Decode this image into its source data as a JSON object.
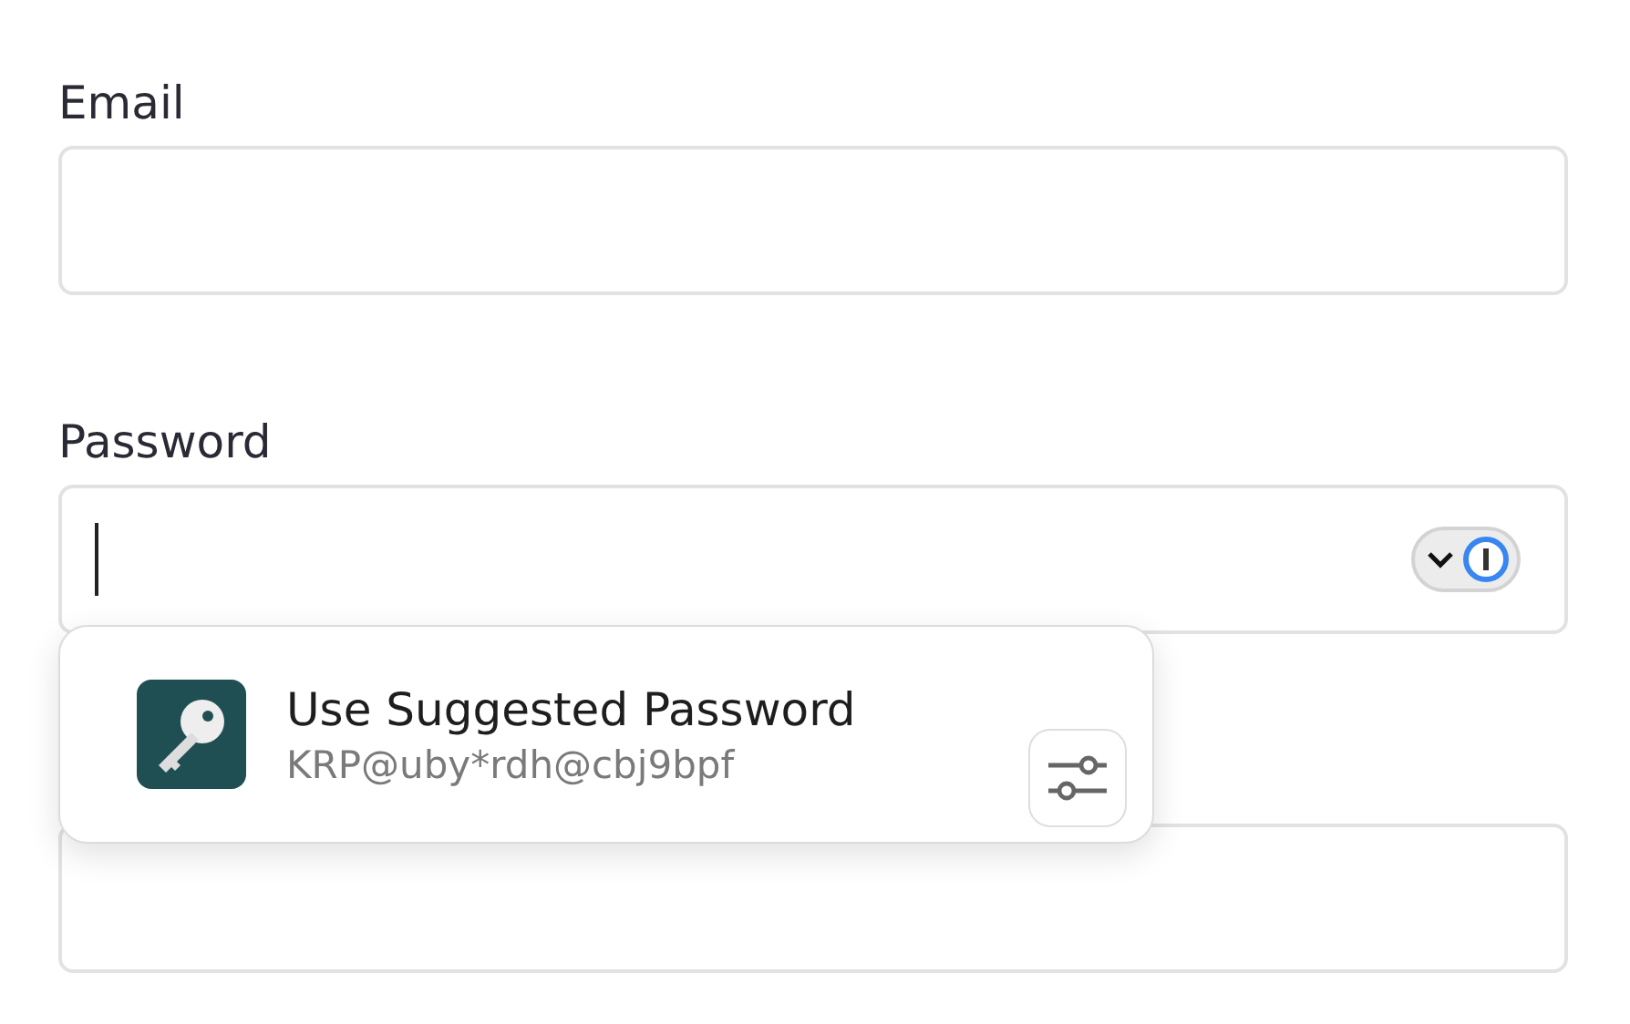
{
  "fields": [
    {
      "label": "Email",
      "kind": "text"
    },
    {
      "label": "Password",
      "kind": "password",
      "focused": true
    },
    {
      "kind": "text"
    }
  ],
  "suggestion": {
    "title": "Use Suggested Password",
    "password": "KRP@uby*rdh@cbj9bpf"
  }
}
